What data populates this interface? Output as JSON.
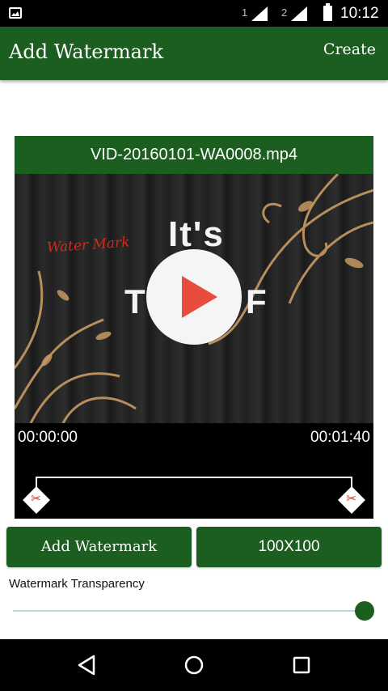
{
  "status_bar": {
    "sim1": "1",
    "sim2": "2",
    "time": "10:12",
    "icons": [
      "image-notification-icon",
      "signal-icon",
      "battery-icon"
    ]
  },
  "app_bar": {
    "title": "Add Watermark",
    "action": "Create"
  },
  "video": {
    "filename": "VID-20160101-WA0008.mp4",
    "watermark_text": "Water Mark",
    "overlay_line1": "It's",
    "overlay_line2_left": "T",
    "overlay_line2_right": "F",
    "start_time": "00:00:00",
    "end_time": "00:01:40"
  },
  "buttons": {
    "add_watermark": "Add Watermark",
    "size": "100X100"
  },
  "transparency": {
    "label": "Watermark Transparency",
    "value": 1.0
  },
  "colors": {
    "primary": "#1b5e20",
    "play_icon": "#e84c3d",
    "slider_track": "#b8d9dc"
  },
  "nav": [
    "back-icon",
    "home-icon",
    "recents-icon"
  ]
}
